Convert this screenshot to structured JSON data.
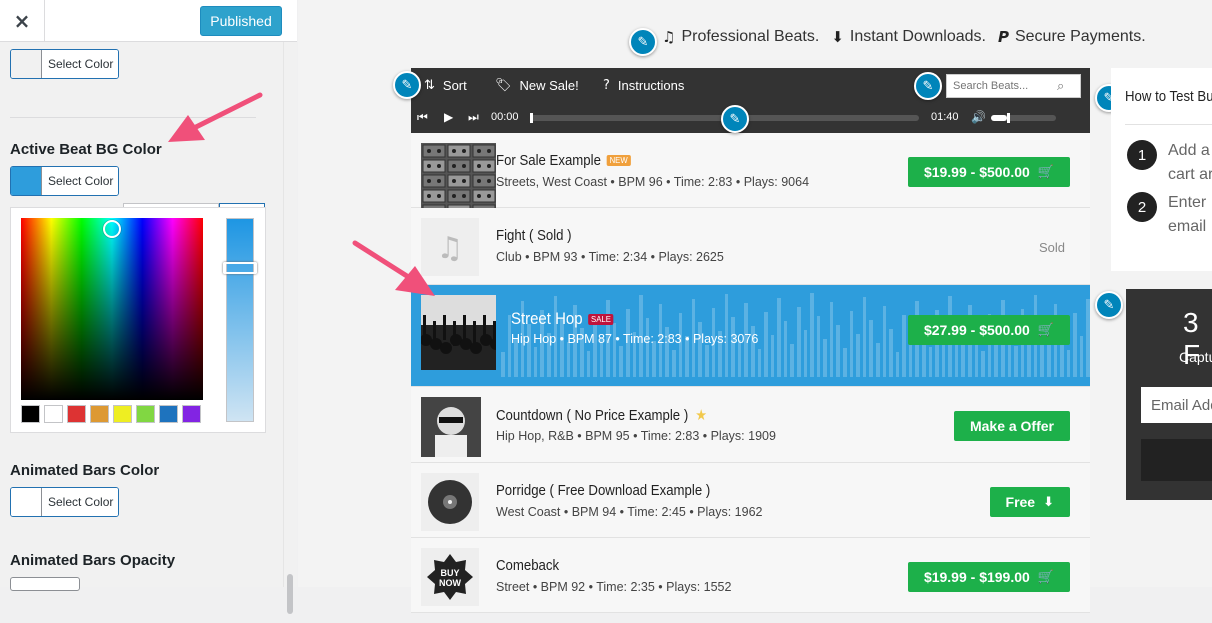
{
  "customizer": {
    "close_icon": "×",
    "publish_label": "Published",
    "select_color_label": "Select Color",
    "sections": [
      {
        "title": "",
        "swatch": "#f1f1f1"
      },
      {
        "title": "Active Beat BG Color",
        "swatch": "#2e9ddc"
      },
      {
        "title": "Animated Bars Color",
        "swatch": "#ffffff"
      },
      {
        "title": "Animated Bars Opacity",
        "swatch": ""
      }
    ],
    "palette": [
      "#000000",
      "#ffffff",
      "#dd3333",
      "#dd9933",
      "#eeee22",
      "#81d742",
      "#1e73be",
      "#8224e3"
    ]
  },
  "preview": {
    "tagline": [
      {
        "icon": "music-icon",
        "glyph": "♫",
        "text": "Professional Beats."
      },
      {
        "icon": "download-icon",
        "glyph": "⬇",
        "text": "Instant Downloads."
      },
      {
        "icon": "paypal-icon",
        "glyph": "P",
        "text": "Secure Payments."
      }
    ],
    "toolbar": {
      "sort": "Sort",
      "new_sale": "New Sale!",
      "instructions": "Instructions",
      "search_placeholder": "Search Beats..."
    },
    "player": {
      "current_time": "00:00",
      "total_time": "01:40",
      "progress": 0.0,
      "volume": 0.25
    },
    "tracks": [
      {
        "title": "For Sale Example",
        "badge": "NEW",
        "meta": "Streets, West Coast • BPM 96 • Time: 2:83 • Plays: 9064",
        "action": "$19.99 - $500.00",
        "action_icon": "cart-icon",
        "thumb": "cassettes"
      },
      {
        "title": "Fight ( Sold )",
        "badge": "",
        "meta": "Club • BPM 93 • Time: 2:34 • Plays: 2625",
        "action": "Sold",
        "action_icon": "",
        "thumb": "music-note"
      },
      {
        "title": "Street Hop",
        "badge": "SALE",
        "meta": "Hip Hop • BPM 87 • Time: 2:83 • Plays: 3076",
        "action": "$27.99 - $500.00",
        "action_icon": "cart-icon",
        "thumb": "crowd"
      },
      {
        "title": "Countdown ( No Price Example )",
        "badge": "★",
        "meta": "Hip Hop, R&B • BPM 95 • Time: 2:83 • Plays: 1909",
        "action": "Make a Offer",
        "action_icon": "",
        "thumb": "portrait"
      },
      {
        "title": "Porridge ( Free Download Example )",
        "badge": "",
        "meta": "West Coast • BPM 94 • Time: 2:45 • Plays: 1962",
        "action": "Free",
        "action_icon": "download-icon",
        "thumb": "vinyl"
      },
      {
        "title": "Comeback",
        "badge": "",
        "meta": "Street • BPM 92 • Time: 2:35 • Plays: 1552",
        "action": "$19.99 - $199.00",
        "action_icon": "cart-icon",
        "thumb": "buy-now"
      }
    ],
    "widget_steps": {
      "title": "How to Test Bu",
      "steps": [
        {
          "num": "1",
          "line1": "Add a",
          "line2": "cart ar"
        },
        {
          "num": "2",
          "line1": "Enter",
          "line2": "email"
        }
      ]
    },
    "widget_subscribe": {
      "title": "3 F",
      "subtitle": "Captu",
      "email_placeholder": "Email Add"
    }
  }
}
